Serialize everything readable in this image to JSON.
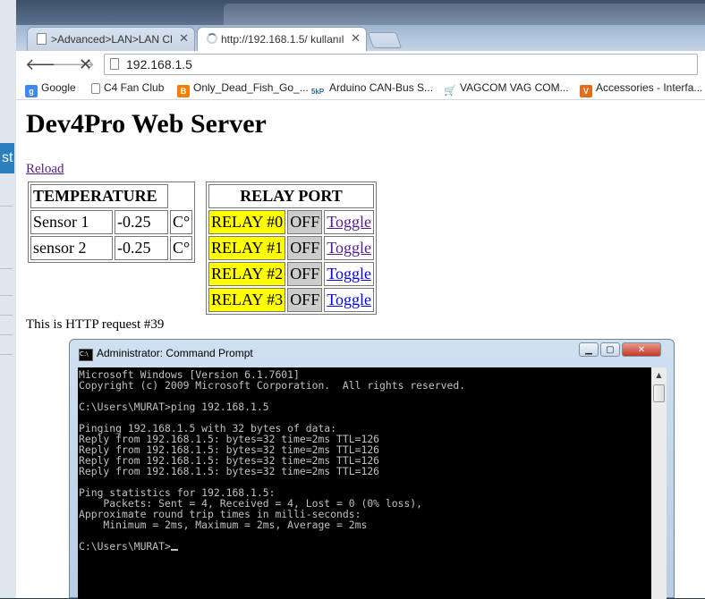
{
  "browser": {
    "tabs": [
      {
        "label": ">Advanced>LAN>LAN Cl",
        "state": "inactive"
      },
      {
        "label": "http://192.168.1.5/ kullanıl",
        "state": "active-loading"
      }
    ],
    "url": "192.168.1.5",
    "bookmarks": [
      {
        "label": "Google",
        "icon": "google-icon",
        "color": "#4285f4"
      },
      {
        "label": "C4 Fan Club",
        "icon": "page-icon",
        "color": "#ffffff"
      },
      {
        "label": "Only_Dead_Fish_Go_...",
        "icon": "blogger-icon",
        "color": "#f57d00"
      },
      {
        "label": "Arduino CAN-Bus S...",
        "icon": "5kp-icon",
        "color": "#4a90c0"
      },
      {
        "label": "VAGCOM VAG COM...",
        "icon": "cart-icon",
        "color": "#d0202a"
      },
      {
        "label": "Accessories - Interfa...",
        "icon": "v-logo-icon",
        "color": "#e56c1a"
      }
    ]
  },
  "page": {
    "heading": "Dev4Pro Web Server",
    "reload_link": "Reload",
    "temperature": {
      "header": "TEMPERATURE",
      "rows": [
        {
          "name": "Sensor 1",
          "value": "-0.25",
          "unit": "C°"
        },
        {
          "name": "sensor 2",
          "value": "-0.25",
          "unit": "C°"
        }
      ]
    },
    "relay": {
      "header": "RELAY PORT",
      "rows": [
        {
          "name": "RELAY #0",
          "state": "OFF",
          "action": "Toggle"
        },
        {
          "name": "RELAY #1",
          "state": "OFF",
          "action": "Toggle"
        },
        {
          "name": "RELAY #2",
          "state": "OFF",
          "action": "Toggle"
        },
        {
          "name": "RELAY #3",
          "state": "OFF",
          "action": "Toggle"
        }
      ]
    },
    "http_request": "This is HTTP request #39"
  },
  "cmd": {
    "title": "Administrator: Command Prompt",
    "lines": [
      "Microsoft Windows [Version 6.1.7601]",
      "Copyright (c) 2009 Microsoft Corporation.  All rights reserved.",
      "",
      "C:\\Users\\MURAT>ping 192.168.1.5",
      "",
      "Pinging 192.168.1.5 with 32 bytes of data:",
      "Reply from 192.168.1.5: bytes=32 time=2ms TTL=126",
      "Reply from 192.168.1.5: bytes=32 time=2ms TTL=126",
      "Reply from 192.168.1.5: bytes=32 time=2ms TTL=126",
      "Reply from 192.168.1.5: bytes=32 time=2ms TTL=126",
      "",
      "Ping statistics for 192.168.1.5:",
      "    Packets: Sent = 4, Received = 4, Lost = 0 (0% loss),",
      "Approximate round trip times in milli-seconds:",
      "    Minimum = 2ms, Maximum = 2ms, Average = 2ms",
      ""
    ],
    "prompt": "C:\\Users\\MURAT>"
  },
  "background": {
    "partial_text": "st"
  }
}
